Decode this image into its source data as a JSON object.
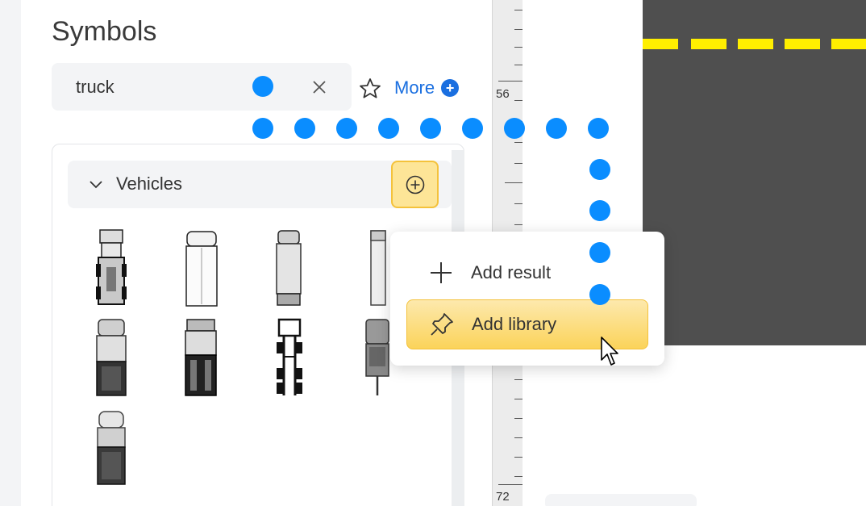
{
  "panel": {
    "title": "Symbols"
  },
  "search": {
    "value": "truck",
    "clear_icon": "close-icon"
  },
  "favorites": {
    "icon": "star-icon"
  },
  "more": {
    "label": "More",
    "icon": "plus-circle-icon"
  },
  "category": {
    "label": "Vehicles",
    "expanded": true,
    "add_icon": "plus-circle-icon"
  },
  "symbols": [
    {
      "name": "semi-truck-cab"
    },
    {
      "name": "box-truck-white"
    },
    {
      "name": "box-truck-grey"
    },
    {
      "name": "trailer-partial"
    },
    {
      "name": "dump-truck-grey"
    },
    {
      "name": "flatbed-truck-black"
    },
    {
      "name": "truck-chassis"
    },
    {
      "name": "tow-truck-partial"
    },
    {
      "name": "pickup-truck"
    }
  ],
  "ruler": {
    "labels": [
      "56",
      "72"
    ]
  },
  "context_menu": {
    "items": [
      {
        "label": "Add result",
        "icon": "plus-icon",
        "active": false
      },
      {
        "label": "Add library",
        "icon": "pushpin-icon",
        "active": true
      }
    ]
  },
  "colors": {
    "accent": "#1a6fe0",
    "highlight": "#fbd35a",
    "road": "#4f4f4f",
    "lane": "#ffef00",
    "marker_dot": "#0a8dff"
  }
}
